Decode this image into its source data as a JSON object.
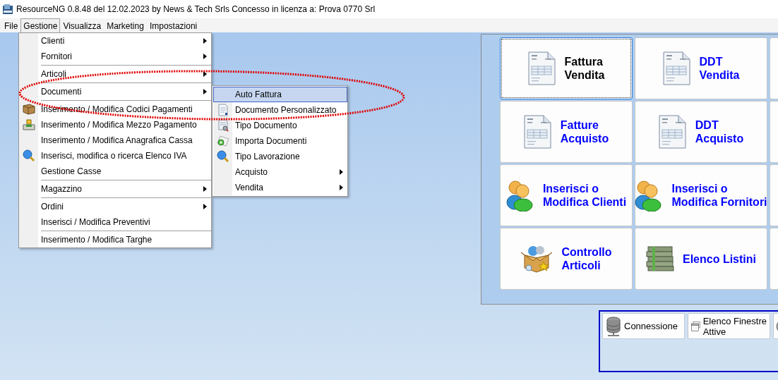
{
  "window": {
    "title": "ResourceNG 0.8.48 del 12.02.2023 by News & Tech Srls Concesso in licenza a: Prova 0770 Srl"
  },
  "menubar": [
    {
      "label": "File",
      "selected": false
    },
    {
      "label": "Gestione",
      "selected": true
    },
    {
      "label": "Visualizza",
      "selected": false
    },
    {
      "label": "Marketing",
      "selected": false
    },
    {
      "label": "Impostazioni",
      "selected": false
    }
  ],
  "menu": {
    "items": [
      {
        "kind": "item",
        "label": "Clienti",
        "submenu": true
      },
      {
        "kind": "item",
        "label": "Fornitori",
        "submenu": true
      },
      {
        "kind": "separator"
      },
      {
        "kind": "item",
        "label": "Articoli",
        "submenu": true
      },
      {
        "kind": "separator"
      },
      {
        "kind": "item",
        "label": "Documenti",
        "submenu": true
      },
      {
        "kind": "separator"
      },
      {
        "kind": "item",
        "label": "Inserimento / Modifica Codici Pagamenti",
        "submenu": false
      },
      {
        "kind": "item",
        "label": "Inserimento / Modifica Mezzo Pagamento",
        "submenu": false
      },
      {
        "kind": "item",
        "label": "Inserimento / Modifica Anagrafica Cassa",
        "submenu": false
      },
      {
        "kind": "item",
        "label": "Inserisci, modifica o ricerca Elenco IVA",
        "submenu": false
      },
      {
        "kind": "item",
        "label": "Gestione Casse",
        "submenu": false
      },
      {
        "kind": "separator"
      },
      {
        "kind": "item",
        "label": "Magazzino",
        "submenu": true
      },
      {
        "kind": "separator"
      },
      {
        "kind": "item",
        "label": "Ordini",
        "submenu": true
      },
      {
        "kind": "item",
        "label": "Inserisci / Modifica Preventivi",
        "submenu": false
      },
      {
        "kind": "separator"
      },
      {
        "kind": "item",
        "label": "Inserimento / Modifica Targhe",
        "submenu": false
      }
    ]
  },
  "submenu": {
    "items": [
      {
        "label": "Auto Fattura",
        "submenu": false,
        "selected": true
      },
      {
        "label": "Documento Personalizzato",
        "submenu": false,
        "selected": false
      },
      {
        "label": "Tipo Documento",
        "submenu": false,
        "selected": false
      },
      {
        "label": "Importa Documenti",
        "submenu": false,
        "selected": false
      },
      {
        "label": "Tipo Lavorazione",
        "submenu": false,
        "selected": false
      },
      {
        "label": "Acquisto",
        "submenu": true,
        "selected": false
      },
      {
        "label": "Vendita",
        "submenu": true,
        "selected": false
      }
    ]
  },
  "tiles": [
    {
      "lines": [
        "Fattura",
        "Vendita"
      ],
      "focused": true
    },
    {
      "lines": [
        "DDT",
        "Vendita"
      ],
      "focused": false
    },
    {
      "lines": [
        "Fatture",
        "Acquisto"
      ],
      "focused": false
    },
    {
      "lines": [
        "DDT",
        "Acquisto"
      ],
      "focused": false
    },
    {
      "lines": [
        "Inserisci o",
        "Modifica Clienti"
      ],
      "focused": false
    },
    {
      "lines": [
        "Inserisci o",
        "Modifica Fornitori"
      ],
      "focused": false
    },
    {
      "lines": [
        "Controllo",
        "Articoli"
      ],
      "focused": false
    },
    {
      "lines": [
        "Elenco Listini"
      ],
      "focused": false
    }
  ],
  "toolbar_buttons": [
    {
      "lines": [
        "Connessione"
      ]
    },
    {
      "lines": [
        "Elenco Finestre",
        "Attive"
      ]
    }
  ]
}
